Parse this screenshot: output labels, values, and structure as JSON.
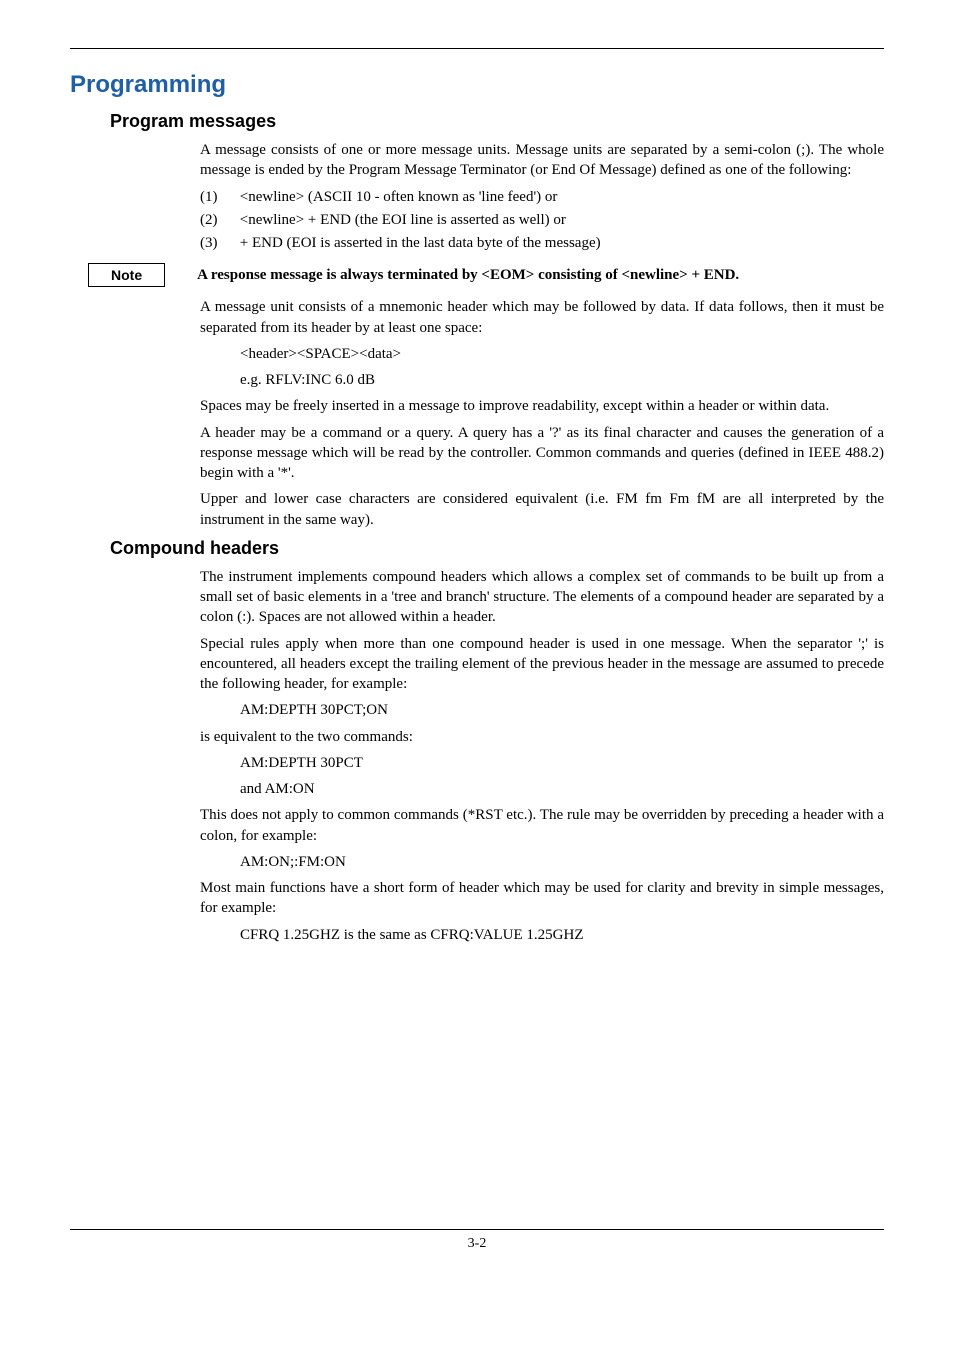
{
  "h1": "Programming",
  "h2a": "Program messages",
  "p1": "A message consists of one or more message units.  Message units are separated by a semi-colon (;).  The whole message is ended by the Program Message Terminator (or End Of Message) defined as one of the following:",
  "li1_num": "(1)",
  "li1": "<newline> (ASCII 10 - often known as 'line feed') or",
  "li2_num": "(2)",
  "li2": "<newline> + END (the EOI line is asserted as well) or",
  "li3_num": "(3)",
  "li3": "+ END (EOI is asserted in the last data byte of the message)",
  "note_label": "Note",
  "note_text": "A response message is always terminated by <EOM> consisting of <newline> + END.",
  "p2": "A message unit consists of a mnemonic header which may be followed by data.  If data follows, then it must be separated from its header by at least one space:",
  "ind1": "<header><SPACE><data>",
  "ind2": "e.g. RFLV:INC   6.0 dB",
  "p3": "Spaces may be freely inserted in a message to improve readability, except within a header or within data.",
  "p4": "A header may be a command or a query.  A query has a '?' as its final character and causes the generation of a response message which will be read by the controller.  Common commands and queries (defined in IEEE 488.2) begin with a '*'.",
  "p5": "Upper and lower case characters are considered equivalent (i.e. FM fm Fm fM are all interpreted by the instrument in the same way).",
  "h2b": "Compound headers",
  "p6": "The instrument implements compound headers which allows a complex set of commands to be built up from a small set of basic elements in a 'tree and branch' structure.  The elements of a compound header are separated by a colon (:).  Spaces are not allowed within a header.",
  "p7": "Special rules apply when more than one compound header is used in one message.  When the separator ';' is encountered, all headers except the trailing element of the previous header in the message are assumed to precede the following header, for example:",
  "ind3": "AM:DEPTH   30PCT;ON",
  "p8": "is equivalent to the two commands:",
  "ind4": "AM:DEPTH   30PCT",
  "ind5": "and AM:ON",
  "p9": "This does not apply to common commands (*RST etc.).  The rule may be overridden by preceding a header with a colon, for example:",
  "ind6": "AM:ON;:FM:ON",
  "p10": "Most main functions have a short form of header which may be used for clarity and brevity in simple messages, for example:",
  "ind7": "CFRQ 1.25GHZ is the same as CFRQ:VALUE   1.25GHZ",
  "footer": "3-2"
}
